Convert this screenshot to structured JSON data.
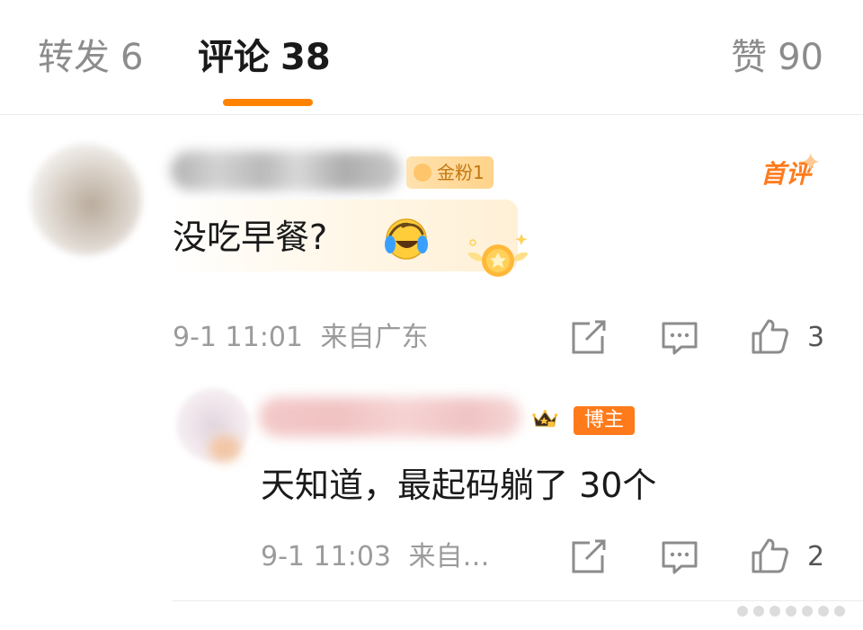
{
  "tabs": {
    "repost": {
      "label": "转发",
      "count": "6"
    },
    "comments": {
      "label": "评论",
      "count": "38"
    },
    "likes": {
      "label": "赞",
      "count": "90"
    }
  },
  "comment": {
    "fan_badge": "金粉1",
    "first_badge": "首评",
    "text": "没吃早餐?",
    "emoji": "laughing-crying-emoji",
    "time": "9-1 11:01",
    "location": "来自广东",
    "like_count": "3"
  },
  "reply": {
    "badge_label": "博主",
    "badge_level": "II",
    "text": "天知道，最起码躺了 30个",
    "time": "9-1 11:03",
    "location": "来自…",
    "like_count": "2"
  },
  "colors": {
    "accent": "#ff8200",
    "muted_text": "#9b9b9b",
    "blogger_badge": "#ff7a1a"
  }
}
